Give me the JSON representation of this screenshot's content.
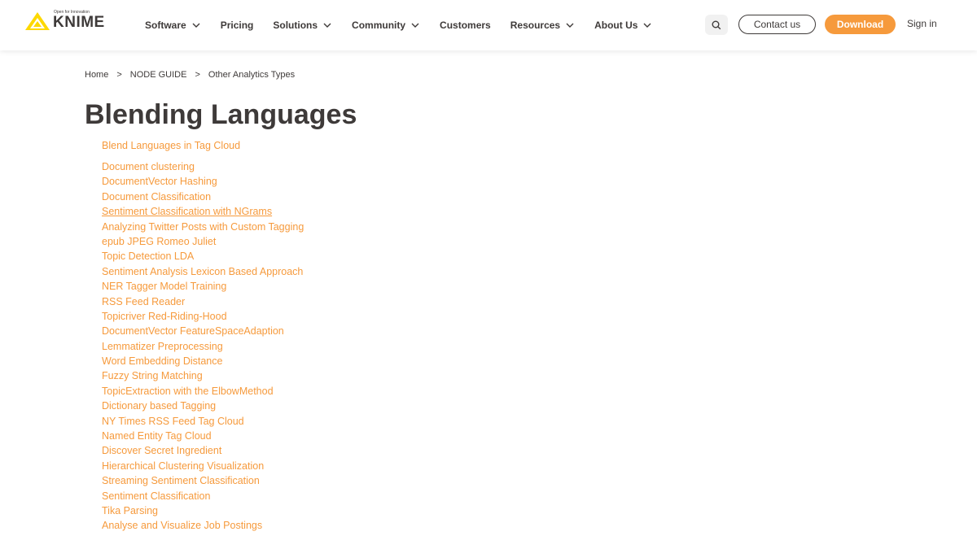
{
  "brand": {
    "tagline": "Open for Innovation",
    "name": "KNIME",
    "accent_color": "#f69a3c",
    "text_color": "#3e3a39"
  },
  "nav": {
    "items": [
      {
        "label": "Software",
        "dropdown": true
      },
      {
        "label": "Pricing",
        "dropdown": false
      },
      {
        "label": "Solutions",
        "dropdown": true
      },
      {
        "label": "Community",
        "dropdown": true
      },
      {
        "label": "Customers",
        "dropdown": false
      },
      {
        "label": "Resources",
        "dropdown": true
      },
      {
        "label": "About Us",
        "dropdown": true
      }
    ],
    "search_icon": "search-icon",
    "contact_label": "Contact us",
    "download_label": "Download",
    "signin_label": "Sign in"
  },
  "breadcrumb": {
    "items": [
      "Home",
      "NODE GUIDE",
      "Other Analytics Types"
    ],
    "separator": ">"
  },
  "page": {
    "title": "Blending Languages",
    "top_link": "Blend Languages in Tag Cloud",
    "links": [
      "Document clustering",
      "DocumentVector Hashing",
      "Document Classification",
      "Sentiment Classification with NGrams",
      "Analyzing Twitter Posts with Custom Tagging",
      "epub JPEG Romeo Juliet",
      "Topic Detection LDA",
      "Sentiment Analysis Lexicon Based Approach",
      "NER Tagger Model Training",
      "RSS Feed Reader",
      "Topicriver Red-Riding-Hood",
      "DocumentVector FeatureSpaceAdaption",
      "Lemmatizer Preprocessing",
      "Word Embedding Distance",
      "Fuzzy String Matching",
      "TopicExtraction with the ElbowMethod",
      "Dictionary based Tagging",
      "NY Times RSS Feed Tag Cloud",
      "Named Entity Tag Cloud",
      "Discover Secret Ingredient",
      "Hierarchical Clustering Visualization",
      "Streaming Sentiment Classification",
      "Sentiment Classification",
      "Tika Parsing",
      "Analyse and Visualize Job Postings"
    ],
    "hovered_link": "Sentiment Classification with NGrams"
  }
}
